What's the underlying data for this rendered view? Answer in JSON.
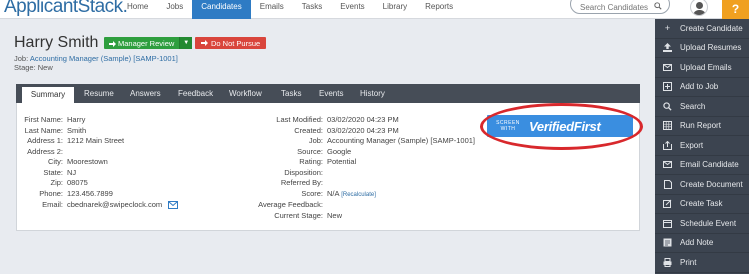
{
  "app": {
    "logo": "ApplicantStack."
  },
  "nav": [
    "Home",
    "Jobs",
    "Candidates",
    "Emails",
    "Tasks",
    "Events",
    "Library",
    "Reports"
  ],
  "search": {
    "placeholder": "Search Candidates"
  },
  "help_label": "?",
  "candidate": {
    "name": "Harry Smith",
    "status_button": "Manager Review",
    "do_not_pursue": "Do Not Pursue",
    "job_prefix": "Job:",
    "job_link": "Accounting Manager (Sample) [SAMP-1001]",
    "stage_line": "Stage: New"
  },
  "tabs": [
    "Summary",
    "Resume",
    "Answers",
    "Feedback",
    "Workflow",
    "Tasks",
    "Events",
    "History"
  ],
  "summary_left": [
    {
      "label": "First Name:",
      "value": "Harry"
    },
    {
      "label": "Last Name:",
      "value": "Smith"
    },
    {
      "label": "Address 1:",
      "value": "1212 Main Street"
    },
    {
      "label": "Address 2:",
      "value": ""
    },
    {
      "label": "City:",
      "value": "Moorestown"
    },
    {
      "label": "State:",
      "value": "NJ"
    },
    {
      "label": "Zip:",
      "value": "08075"
    },
    {
      "label": "Phone:",
      "value": "123.456.7899"
    },
    {
      "label": "Email:",
      "value": "cbednarek@swipeclock.com"
    }
  ],
  "summary_right": [
    {
      "label": "Last Modified:",
      "value": "03/02/2020 04:23 PM"
    },
    {
      "label": "Created:",
      "value": "03/02/2020 04:23 PM"
    },
    {
      "label": "Job:",
      "value": "Accounting Manager (Sample) [SAMP-1001]"
    },
    {
      "label": "Source:",
      "value": "Google"
    },
    {
      "label": "Rating:",
      "value": "Potential"
    },
    {
      "label": "Disposition:",
      "value": ""
    },
    {
      "label": "Referred By:",
      "value": ""
    },
    {
      "label": "Score:",
      "value": "N/A"
    },
    {
      "label": "Average Feedback:",
      "value": ""
    },
    {
      "label": "Current Stage:",
      "value": "New"
    }
  ],
  "recalculate": "[Recalculate]",
  "verified_first": {
    "small_line1": "SCREEN",
    "small_line2": "WITH",
    "brand": "VerifiedFirst"
  },
  "sidebar": [
    {
      "icon": "plus-icon",
      "label": "Create Candidate"
    },
    {
      "icon": "upload-icon",
      "label": "Upload Resumes"
    },
    {
      "icon": "envelope-icon",
      "label": "Upload Emails"
    },
    {
      "icon": "add-icon",
      "label": "Add to Job"
    },
    {
      "icon": "search-icon",
      "label": "Search"
    },
    {
      "icon": "table-icon",
      "label": "Run Report"
    },
    {
      "icon": "export-icon",
      "label": "Export"
    },
    {
      "icon": "envelope-icon",
      "label": "Email Candidate"
    },
    {
      "icon": "document-icon",
      "label": "Create Document"
    },
    {
      "icon": "edit-icon",
      "label": "Create Task"
    },
    {
      "icon": "calendar-icon",
      "label": "Schedule Event"
    },
    {
      "icon": "note-icon",
      "label": "Add Note"
    },
    {
      "icon": "print-icon",
      "label": "Print"
    }
  ],
  "colors": {
    "accent": "#2e7bc4",
    "green": "#2e9e3e",
    "red": "#d9453c",
    "sidebar": "#3c4450",
    "help": "#f0a020",
    "verified": "#3a8ee0",
    "highlight": "#d8282c"
  }
}
